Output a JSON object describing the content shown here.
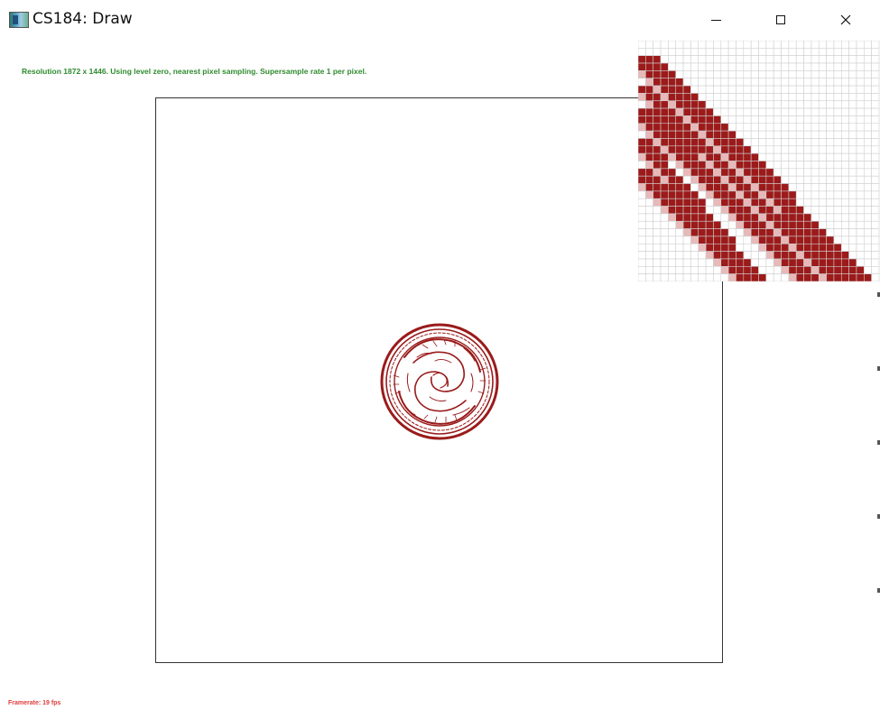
{
  "window": {
    "title": "CS184: Draw",
    "icon": "app-window-icon",
    "controls": [
      "minimize-icon",
      "maximize-icon",
      "close-icon"
    ]
  },
  "status": {
    "text": "Resolution 1872 x 1446. Using level zero, nearest pixel sampling. Supersample rate 1 per pixel.",
    "color": "#2e8b2e"
  },
  "framerate": {
    "text": "Framerate: 19 fps",
    "color": "#e03c3c"
  },
  "drawing": {
    "stroke_color": "#9a1b1b",
    "zoom_dark_color": "#9c1a1a",
    "zoom_light_color": "#e7b9b9",
    "zoom_grid_color": "#cfcfcf"
  }
}
